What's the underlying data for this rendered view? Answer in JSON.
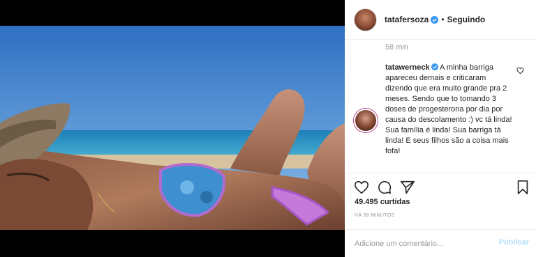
{
  "post": {
    "image_alt_icon": "beach-photo",
    "author": "tatafersoza",
    "separator": "•",
    "follow_status": "Seguindo",
    "caption_time": "58 min"
  },
  "comment": {
    "user": "tatawerneck",
    "text": " A minha barriga apareceu demais e criticaram dizendo que era muito grande pra 2 meses. Sendo que to tomando 3 doses de progesterona por dia por causa do descolamento :) vc tá linda! Sua família é linda! Sua barriga tá linda! E seus filhos são a coisa mais fofa!"
  },
  "stats": {
    "likes": "49.495 curtidas",
    "time_ago": "há 58 minutos"
  },
  "composer": {
    "placeholder": "Adicione um comentário...",
    "publish_label": "Publicar"
  },
  "colors": {
    "verified": "#3897f0",
    "publish": "#b2dffc",
    "text": "#262626",
    "muted": "#999999"
  }
}
